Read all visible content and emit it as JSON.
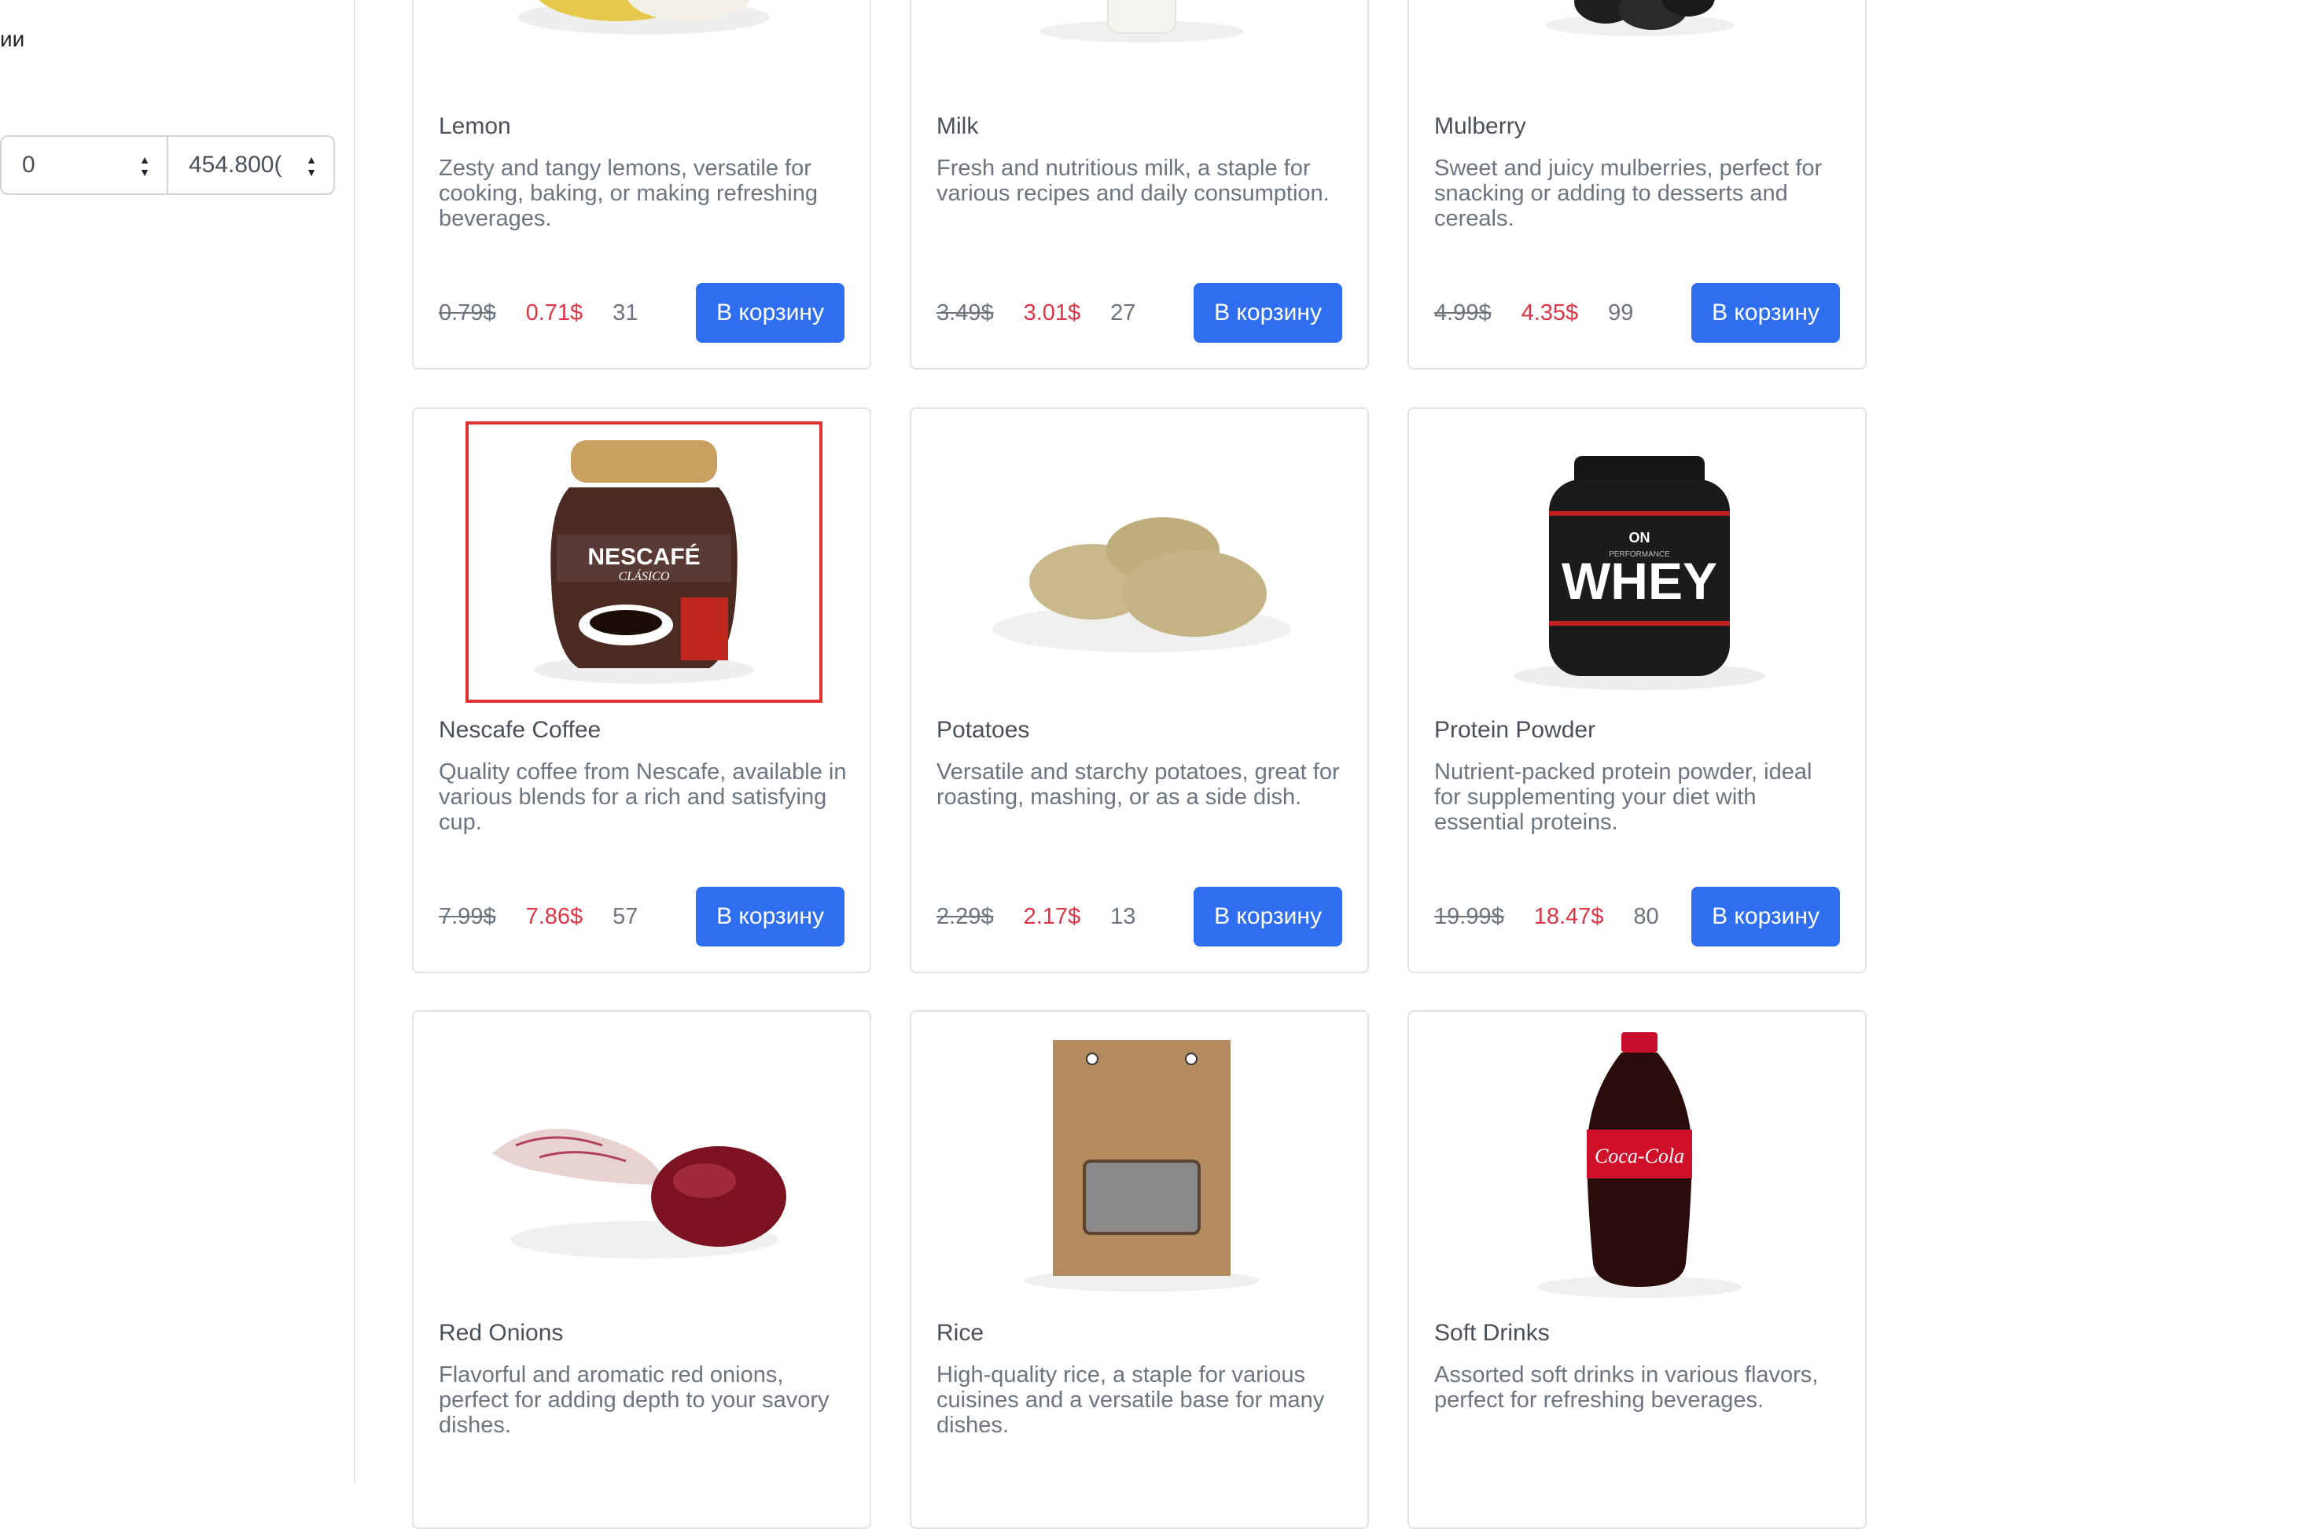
{
  "sidebar": {
    "filter_label": "ии",
    "price_min": "0",
    "price_max": "454.800(",
    "spinner_up": "▲",
    "spinner_down": "▼"
  },
  "products": [
    {
      "title": "Lemon",
      "desc": "Zesty and tangy lemons, versatile for cooking, baking, or making refreshing beverages.",
      "old_price": "0.79$",
      "new_price": "0.71$",
      "qty": "31",
      "button": "В корзину"
    },
    {
      "title": "Milk",
      "desc": "Fresh and nutritious milk, a staple for various recipes and daily consumption.",
      "old_price": "3.49$",
      "new_price": "3.01$",
      "qty": "27",
      "button": "В корзину"
    },
    {
      "title": "Mulberry",
      "desc": "Sweet and juicy mulberries, perfect for snacking or adding to desserts and cereals.",
      "old_price": "4.99$",
      "new_price": "4.35$",
      "qty": "99",
      "button": "В корзину"
    },
    {
      "title": "Nescafe Coffee",
      "desc": "Quality coffee from Nescafe, available in various blends for a rich and satisfying cup.",
      "old_price": "7.99$",
      "new_price": "7.86$",
      "qty": "57",
      "button": "В корзину",
      "label_brand": "NESCAFÉ",
      "label_sub": "CLÁSICO"
    },
    {
      "title": "Potatoes",
      "desc": "Versatile and starchy potatoes, great for roasting, mashing, or as a side dish.",
      "old_price": "2.29$",
      "new_price": "2.17$",
      "qty": "13",
      "button": "В корзину"
    },
    {
      "title": "Protein Powder",
      "desc": "Nutrient-packed protein powder, ideal for supplementing your diet with essential proteins.",
      "old_price": "19.99$",
      "new_price": "18.47$",
      "qty": "80",
      "button": "В корзину",
      "label_brand": "ON",
      "label_sub": "PERFORMANCE",
      "label_main": "WHEY"
    },
    {
      "title": "Red Onions",
      "desc": "Flavorful and aromatic red onions, perfect for adding depth to your savory dishes."
    },
    {
      "title": "Rice",
      "desc": "High-quality rice, a staple for various cuisines and a versatile base for many dishes."
    },
    {
      "title": "Soft Drinks",
      "desc": "Assorted soft drinks in various flavors, perfect for refreshing beverages.",
      "label_brand": "Coca-Cola"
    }
  ],
  "colors": {
    "accent": "#2f6fef",
    "sale": "#dc3545",
    "highlight": "#e03131"
  }
}
